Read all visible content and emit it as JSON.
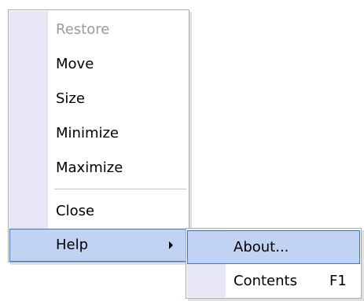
{
  "main_menu": {
    "items": [
      {
        "label": "Restore",
        "state": "disabled"
      },
      {
        "label": "Move"
      },
      {
        "label": "Size"
      },
      {
        "label": "Minimize"
      },
      {
        "label": "Maximize"
      },
      {
        "label": "Close"
      },
      {
        "label": "Help",
        "state": "highlighted",
        "has_submenu": true
      }
    ]
  },
  "help_submenu": {
    "items": [
      {
        "label": "About...",
        "state": "highlighted"
      },
      {
        "label": "Contents",
        "shortcut": "F1"
      }
    ]
  },
  "colors": {
    "gutter": "#e6e6f7",
    "highlight_fill": "#c1d3f3",
    "highlight_border": "#3c74d6",
    "disabled_text": "#9b9b9b"
  }
}
